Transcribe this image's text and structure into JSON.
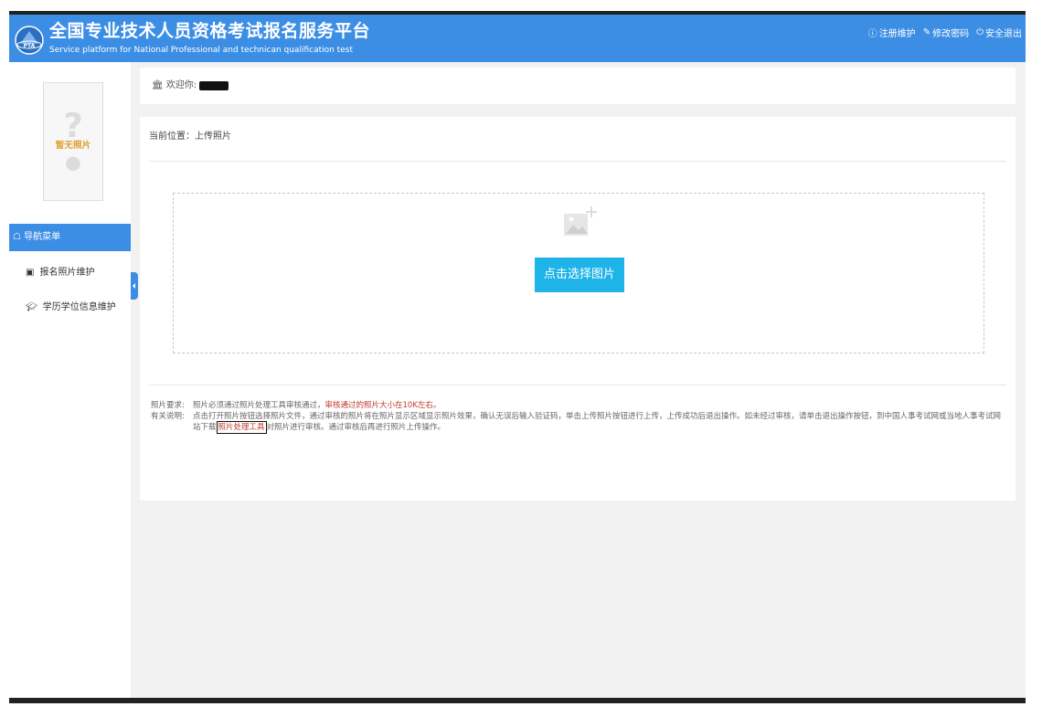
{
  "header": {
    "title_cn": "全国专业技术人员资格考试报名服务平台",
    "title_en": "Service platform for National Professional and technican qualification test",
    "logo_text": "PTA",
    "links": [
      {
        "label": "注册维护",
        "icon": "info-circle-icon"
      },
      {
        "label": "修改密码",
        "icon": "edit-icon"
      },
      {
        "label": "安全退出",
        "icon": "power-icon"
      }
    ],
    "bg_color": "#3c8ee5"
  },
  "sidebar": {
    "photo_placeholder": "暂无照片",
    "nav_header": "导航菜单",
    "items": [
      {
        "label": "报名照片维护",
        "icon": "image-icon"
      },
      {
        "label": "学历学位信息维护",
        "icon": "graduation-cap-icon"
      }
    ]
  },
  "welcome": {
    "label": "欢迎你:",
    "icon": "bank-icon"
  },
  "main": {
    "breadcrumb": "当前位置：上传照片",
    "choose_button": "点击选择图片",
    "button_color": "#1fb4e8",
    "notes": {
      "req_label": "照片要求:",
      "req_text_plain": "照片必须通过照片处理工具审核通过，",
      "req_text_red": "审核通过的照片大小在10K左右。",
      "desc_label": "有关说明:",
      "desc_text_1": "点击打开照片按钮选择照片文件，通过审核的照片将在照片显示区域显示照片效果，确认无误后输入验证码，单击上传照片按钮进行上传，上传成功后退出操作。如未经过审核，请单击退出操作按钮，到中国人事考试网或当地人事考试网站下载",
      "desc_link": "照片处理工具",
      "desc_text_2": "对照片进行审核。通过审核后再进行照片上传操作。"
    }
  }
}
